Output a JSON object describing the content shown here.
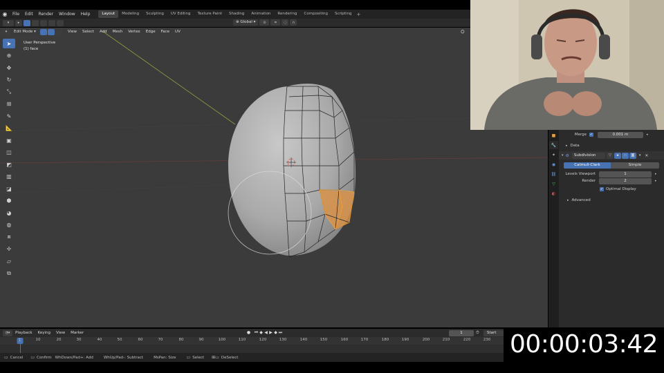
{
  "topbar": {
    "menus": [
      "File",
      "Edit",
      "Render",
      "Window",
      "Help"
    ],
    "workspaces": [
      "Layout",
      "Modeling",
      "Sculpting",
      "UV Editing",
      "Texture Paint",
      "Shading",
      "Animation",
      "Rendering",
      "Compositing",
      "Scripting"
    ],
    "active_workspace": "Layout"
  },
  "tool_header": {
    "orientation": "Global"
  },
  "viewport_header": {
    "mode": "Edit Mode",
    "menus": [
      "View",
      "Select",
      "Add",
      "Mesh",
      "Vertex",
      "Edge",
      "Face",
      "UV"
    ]
  },
  "viewport": {
    "view_name": "User Perspective",
    "selection_info": "(1) face"
  },
  "toolbar": {
    "tools": [
      "select-box",
      "cursor",
      "move",
      "rotate",
      "scale",
      "transform",
      "annotate",
      "measure",
      "extrude",
      "inset",
      "bevel",
      "loop-cut",
      "knife",
      "poly-build",
      "spin",
      "smooth",
      "edge-slide",
      "shrink-fatten",
      "shear",
      "rip"
    ]
  },
  "properties": {
    "merge_label": "Merge",
    "merge_value": "0.001 m",
    "data_label": "Data",
    "modifier_name": "Subdivision",
    "algorithm_options": [
      "Catmull-Clark",
      "Simple"
    ],
    "active_algorithm": "Catmull-Clark",
    "levels_viewport_label": "Levels Viewport",
    "levels_viewport_value": "1",
    "render_label": "Render",
    "render_value": "2",
    "optimal_display_label": "Optimal Display",
    "advanced_label": "Advanced"
  },
  "timeline": {
    "menus": [
      "Playback",
      "Keying",
      "View",
      "Marker"
    ],
    "current_frame": "1",
    "start_label": "Start",
    "ruler_ticks": [
      "10",
      "20",
      "30",
      "40",
      "50",
      "60",
      "70",
      "80",
      "90",
      "100",
      "110",
      "120",
      "130",
      "140",
      "150",
      "160",
      "170",
      "180",
      "190",
      "200",
      "210",
      "220",
      "230"
    ],
    "playhead_frame": "1"
  },
  "statusbar": {
    "cancel": "Cancel",
    "confirm": "Confirm",
    "wheel_add": "WhDown/Pad+: Add",
    "wheel_subtract": "WhUp/Pad-: Subtract",
    "ms_pan": "MsPan: Size",
    "select": "Select",
    "deselect": "DeSelect"
  },
  "overlay": {
    "timer": "00:00:03:42"
  },
  "colors": {
    "accent": "#4772b3",
    "viewport_bg": "#3b3b3b",
    "selection": "#f5a030"
  }
}
